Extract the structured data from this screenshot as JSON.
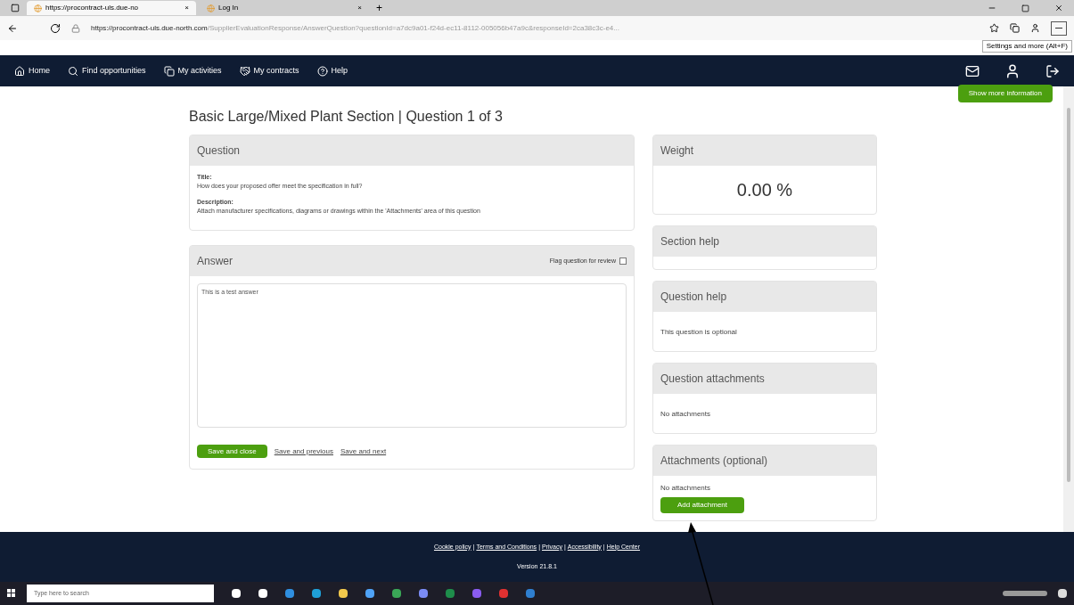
{
  "browser": {
    "tabs": [
      {
        "label": "https://procontract-uls.due-no",
        "selected": true,
        "close": "×"
      },
      {
        "label": "Log In",
        "selected": false,
        "close": "×"
      }
    ],
    "new_tab": "+",
    "url_host": "https://procontract-uls.due-north.com",
    "url_path": "/SupplierEvaluationResponse/AnswerQuestion?questionId=a7dc9a01-f24d-ec11-8112-005056b47a9c&responseId=2ca38c3c-e4...",
    "tooltip": "Settings and more (Alt+F)"
  },
  "nav": {
    "items": [
      {
        "label": "Home"
      },
      {
        "label": "Find opportunities"
      },
      {
        "label": "My activities"
      },
      {
        "label": "My contracts"
      },
      {
        "label": "Help"
      }
    ],
    "more_button": "Show more information"
  },
  "page_title": "Basic Large/Mixed Plant Section | Question 1 of 3",
  "question": {
    "heading": "Question",
    "title_label": "Title:",
    "title": "How does your proposed offer meet the specification in full?",
    "description_label": "Description:",
    "description": "Attach manufacturer specifications, diagrams or drawings within the 'Attachments' area of this question"
  },
  "answer": {
    "heading": "Answer",
    "flag_label": "Flag question for review",
    "flagged": false,
    "value": "This is a test answer",
    "buttons": [
      {
        "label": "Save and close",
        "kind": "primary"
      },
      {
        "label": "Save and previous",
        "kind": "link"
      },
      {
        "label": "Save and next",
        "kind": "link"
      }
    ]
  },
  "side_panels": [
    {
      "heading": "Weight",
      "kind": "weight",
      "text": "0.00 %"
    },
    {
      "heading": "Section help",
      "kind": "empty"
    },
    {
      "heading": "Question help",
      "kind": "text",
      "text": "This question is optional"
    },
    {
      "heading": "Question attachments",
      "kind": "text",
      "text": "No attachments"
    },
    {
      "heading": "Attachments (optional)",
      "kind": "attach",
      "text": "No attachments",
      "button": "Add attachment"
    }
  ],
  "footer": {
    "links": [
      "Cookie policy",
      "Terms and Conditions",
      "Privacy",
      "Accessibility",
      "Help Center"
    ],
    "separator": "|",
    "version": "Version 21.8.1"
  },
  "taskbar": {
    "search_placeholder": "Type here to search"
  }
}
